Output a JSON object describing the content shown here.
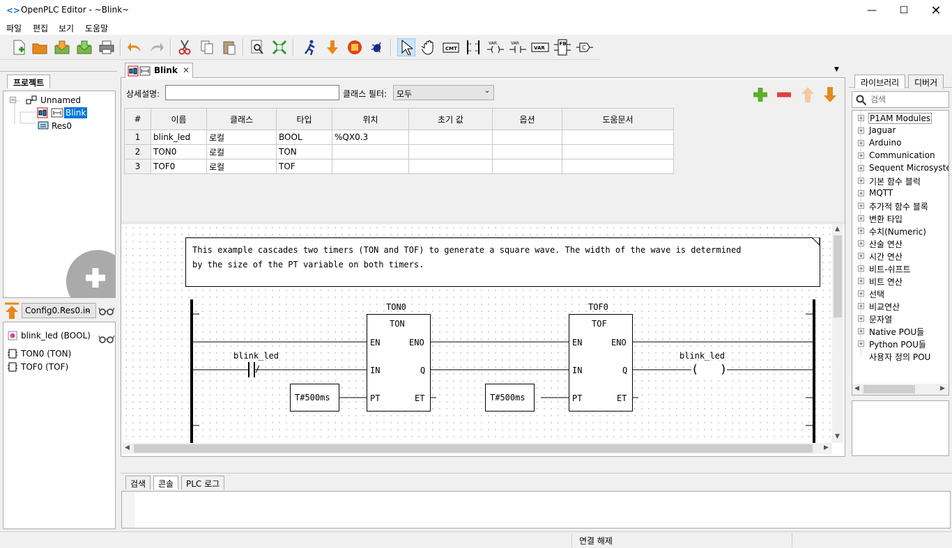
{
  "window": {
    "title": "OpenPLC Editor - ~Blink~"
  },
  "menu": [
    "파일",
    "편집",
    "보기",
    "도움말"
  ],
  "project": {
    "tab_label": "프로젝트",
    "tree": {
      "root": "Unnamed",
      "pou": "Blink",
      "resource": "Res0"
    },
    "instance_select": "Config0.Res0.in",
    "debug_vars": [
      {
        "label": "blink_led (BOOL)"
      },
      {
        "label": "TON0 (TON)"
      },
      {
        "label": "TOF0 (TOF)"
      }
    ]
  },
  "editor": {
    "tab_label": "Blink",
    "description_label": "상세설명:",
    "description_value": "",
    "class_filter_label": "클래스 필터:",
    "class_filter_value": "모두",
    "columns": [
      "#",
      "이름",
      "클래스",
      "타입",
      "위치",
      "초기 값",
      "옵션",
      "도움문서"
    ],
    "rows": [
      {
        "num": "1",
        "name": "blink_led",
        "class": "로컬",
        "type": "BOOL",
        "location": "%QX0.3",
        "initial": "",
        "option": "",
        "doc": ""
      },
      {
        "num": "2",
        "name": "TON0",
        "class": "로컬",
        "type": "TON",
        "location": "",
        "initial": "",
        "option": "",
        "doc": ""
      },
      {
        "num": "3",
        "name": "TOF0",
        "class": "로컬",
        "type": "TOF",
        "location": "",
        "initial": "",
        "option": "",
        "doc": ""
      }
    ]
  },
  "ladder": {
    "comment_line1": "This example cascades two timers (TON and TOF) to generate a square wave. The width of the wave is determined",
    "comment_line2": "by the size of the PT variable on both timers.",
    "ton": {
      "instance": "TON0",
      "type": "TON",
      "en": "EN",
      "eno": "ENO",
      "in": "IN",
      "q": "Q",
      "pt": "PT",
      "et": "ET",
      "pt_value": "T#500ms"
    },
    "tof": {
      "instance": "TOF0",
      "type": "TOF",
      "en": "EN",
      "eno": "ENO",
      "in": "IN",
      "q": "Q",
      "pt": "PT",
      "et": "ET",
      "pt_value": "T#500ms"
    },
    "contact": {
      "name": "blink_led",
      "symbol": "/"
    },
    "coil": {
      "name": "blink_led",
      "symbol": "(   )"
    }
  },
  "library": {
    "tabs": [
      "라이브러리",
      "디버거"
    ],
    "search_placeholder": "검색",
    "items": [
      "P1AM Modules",
      "Jaguar",
      "Arduino",
      "Communication",
      "Sequent Microsystems",
      "기본 함수 블럭",
      "MQTT",
      "추가적 함수 블록",
      "변환 타입",
      "수치(Numeric)",
      "산술 연산",
      "시간 연산",
      "비트-쉬프트",
      "비트 연산",
      "선택",
      "비교연산",
      "문자열",
      "Native POU들",
      "Python POU들",
      "사용자 정의 POU"
    ]
  },
  "bottom_tabs": [
    "검색",
    "콘솔",
    "PLC 로그"
  ],
  "status": {
    "connection": "연결 해제"
  }
}
